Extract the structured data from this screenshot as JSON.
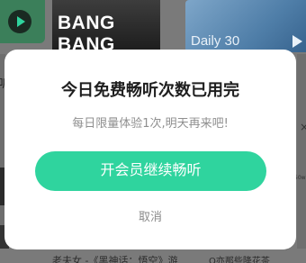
{
  "background": {
    "tiles": {
      "bang_label": "BANG BANG",
      "daily_label": "Daily 30"
    },
    "left_glyph": "听",
    "right_close": "×",
    "right_label": "50w",
    "bottom_title": "老夫女 -《黑神话：悟空》游",
    "bottom_tag": "Q亦那些降花茶"
  },
  "dialog": {
    "title": "今日免费畅听次数已用完",
    "subtitle": "每日限量体验1次,明天再来吧!",
    "primary_button": "开会员继续畅听",
    "cancel": "取消",
    "accent_color": "#2fd49e"
  }
}
